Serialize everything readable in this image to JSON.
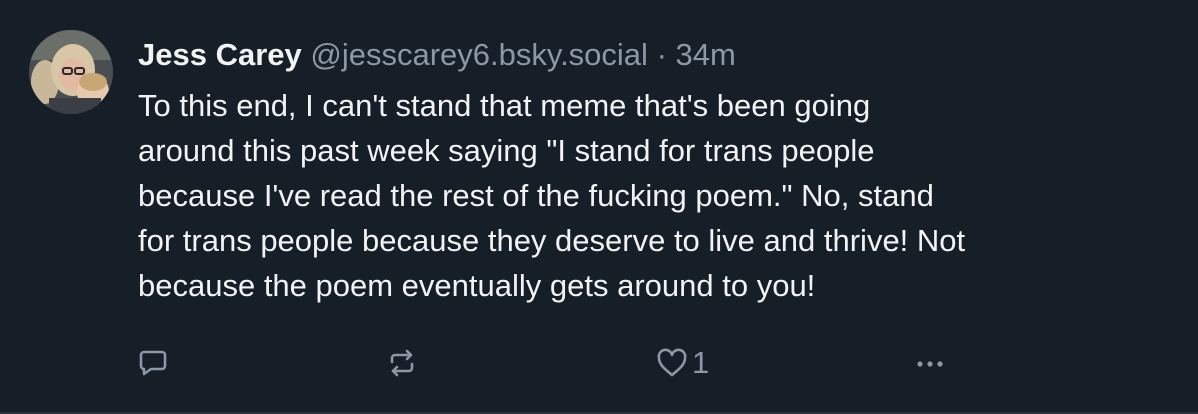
{
  "post": {
    "display_name": "Jess Carey",
    "handle": "@jesscarey6.bsky.social",
    "separator": "·",
    "timestamp": "34m",
    "text_lines": [
      "To this end, I can't stand that meme that's been going",
      "around this past week saying \"I stand for trans people",
      "because I've read the rest of the fucking poem.\" No, stand",
      "for trans people because they deserve to live and thrive! Not",
      "because the poem eventually gets around to you!"
    ]
  },
  "actions": {
    "reply_icon": "speech-bubble-icon",
    "repost_icon": "repost-arrows-icon",
    "like_icon": "heart-outline-icon",
    "like_count": "1",
    "more_icon": "ellipsis-icon"
  },
  "colors": {
    "background": "#161e27",
    "text": "#f1f3f5",
    "muted": "#8b98a5"
  }
}
